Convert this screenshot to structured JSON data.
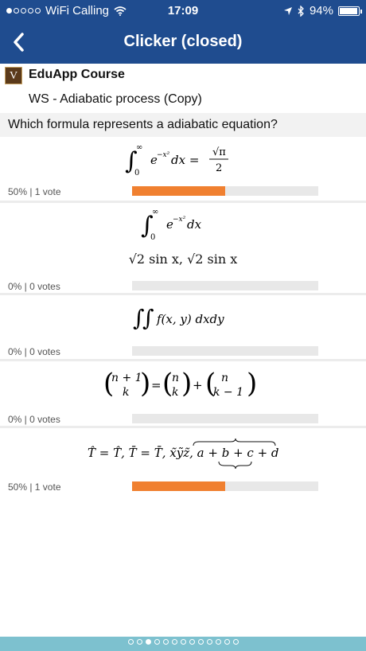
{
  "status": {
    "carrier": "WiFi Calling",
    "time": "17:09",
    "battery": "94%",
    "battery_level": 0.94,
    "signal_bars": [
      true,
      false,
      false,
      false,
      false
    ]
  },
  "nav": {
    "title": "Clicker (closed)",
    "back_icon": "chevron-left-icon"
  },
  "course": {
    "logo": "V",
    "name": "EduApp Course",
    "worksheet": "WS - Adiabatic process (Copy)"
  },
  "question": "Which formula represents a adiabatic equation?",
  "answers": [
    {
      "stat": "50% | 1 vote",
      "percent": 50
    },
    {
      "stat": "0% | 0 votes",
      "percent": 0
    },
    {
      "stat": "0% | 0 votes",
      "percent": 0
    },
    {
      "stat": "0% | 0 votes",
      "percent": 0
    },
    {
      "stat": "50% | 1 vote",
      "percent": 50
    }
  ],
  "formulas": {
    "f1_lhs": "e",
    "f1_sup": "−x²",
    "f1_d": "dx =",
    "f1_num": "√π",
    "f1_den": "2",
    "f2_a": "e",
    "f2_sup": "−x²",
    "f2_d": "dx",
    "f2_line2": "√2 sin x, √2 sin x",
    "f3": "f(x, y) dxdy",
    "f4_lhs_top": "n + 1",
    "f4_lhs_bot": "k",
    "f4_mid_top": "n",
    "f4_mid_bot": "k",
    "f4_rhs_top": "n",
    "f4_rhs_bot": "k − 1",
    "f5": "T̂ = T̂, T̄ = T̄, x̃ỹz̃, a + b + c + d"
  },
  "pager": {
    "count": 13,
    "active_index": 2
  }
}
